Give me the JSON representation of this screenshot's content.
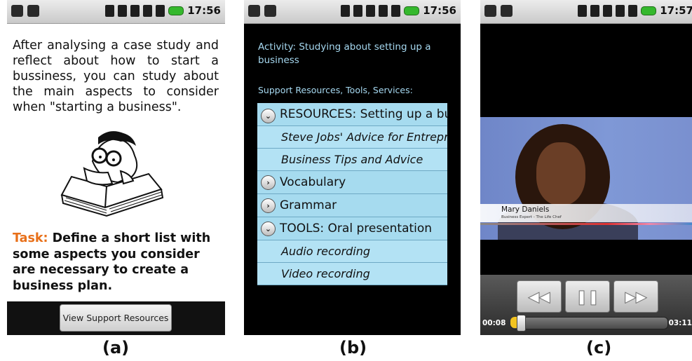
{
  "status_bar": {
    "time_a": "17:56",
    "time_b": "17:56",
    "time_c": "17:57"
  },
  "panel_a": {
    "intro_text": "After analysing a case study and reflect about how to start a bussiness, you can study about the main aspects to consider when \"starting a business\".",
    "task_label": "Task:",
    "task_text": "Define a short list with some aspects you consider are necessary to create a business plan.",
    "button_label": "View Support Resources",
    "illustration_icon": "reader-with-book-icon"
  },
  "panel_b": {
    "activity_text": "Activity: Studying about setting up a business",
    "support_title": "Support Resources, Tools, Services:",
    "tree": [
      {
        "type": "header",
        "expanded": true,
        "label": "RESOURCES: Setting up a business"
      },
      {
        "type": "item",
        "label": "Steve Jobs' Advice for Entrepreneurs"
      },
      {
        "type": "item",
        "label": "Business Tips and Advice"
      },
      {
        "type": "header",
        "expanded": false,
        "label": "Vocabulary"
      },
      {
        "type": "header",
        "expanded": false,
        "label": "Grammar"
      },
      {
        "type": "header",
        "expanded": true,
        "label": "TOOLS: Oral presentation"
      },
      {
        "type": "item",
        "label": "Audio recording"
      },
      {
        "type": "item",
        "label": "Video recording"
      }
    ]
  },
  "panel_c": {
    "lower_third_name": "Mary Daniels",
    "lower_third_role": "Business Expert - The Life Chef",
    "current_time": "00:08",
    "total_time": "03:11",
    "progress_fraction": 0.042
  },
  "captions": {
    "a": "(a)",
    "b": "(b)",
    "c": "(c)"
  },
  "colors": {
    "task_label": "#e8701a",
    "tree_bg": "#a6dbef",
    "activity_text": "#a6d8f0",
    "progress": "#f2c320",
    "battery": "#35b82d"
  }
}
